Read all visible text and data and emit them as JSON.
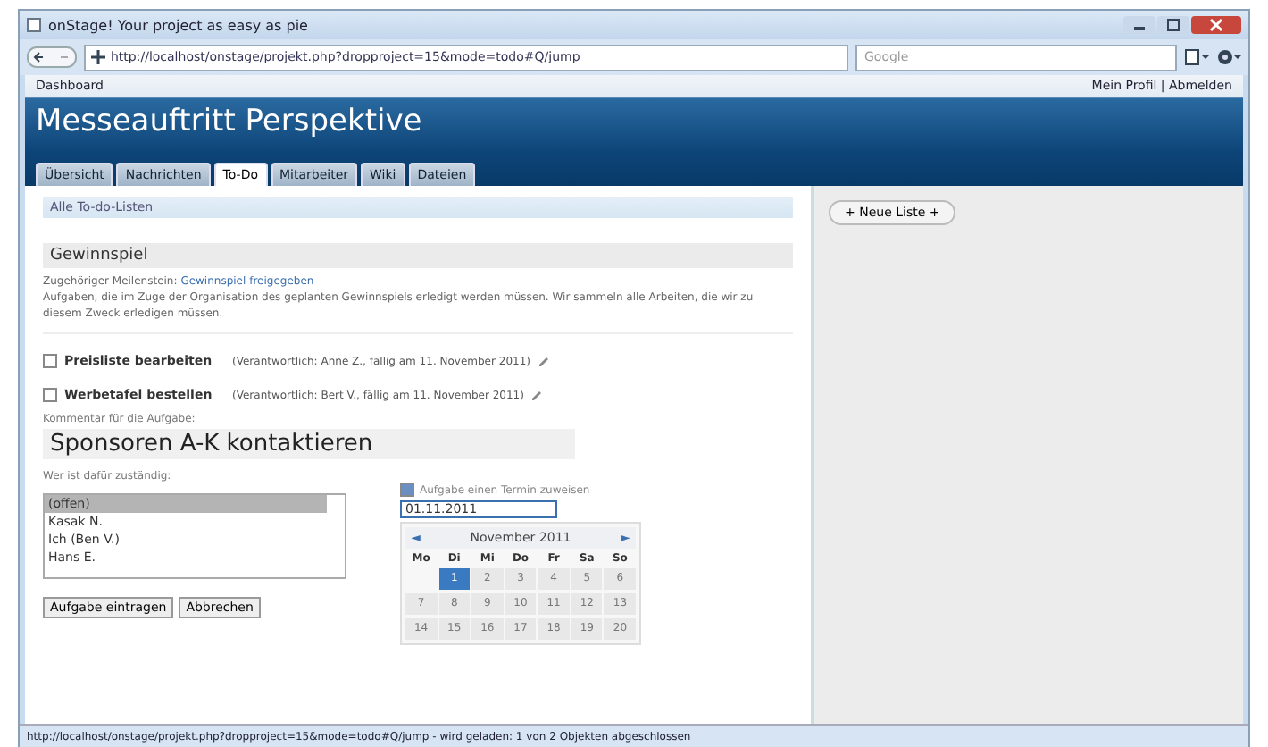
{
  "window": {
    "title": "onStage! Your project as easy as pie"
  },
  "browser": {
    "url": "http://localhost/onstage/projekt.php?dropproject=15&mode=todo#Q/jump",
    "search_placeholder": "Google"
  },
  "header": {
    "breadcrumb": "Dashboard",
    "user_links": "Mein Profil | Abmelden",
    "title": "Messeauftritt Perspektive"
  },
  "tabs": [
    {
      "label": "Übersicht",
      "selected": false
    },
    {
      "label": "Nachrichten",
      "selected": false
    },
    {
      "label": "To-Do",
      "selected": true
    },
    {
      "label": "Mitarbeiter",
      "selected": false
    },
    {
      "label": "Wiki",
      "selected": false
    },
    {
      "label": "Dateien",
      "selected": false
    }
  ],
  "all_lists_link": "Alle To-do-Listen",
  "list": {
    "title": "Gewinnspiel",
    "milestone_label": "Zugehöriger Meilenstein:",
    "milestone_link": "Gewinnspiel freigegeben",
    "description": "Aufgaben, die im Zuge der Organisation des geplanten Gewinnspiels erledigt werden müssen. Wir sammeln alle Arbeiten, die wir zu diesem Zweck erledigen müssen.",
    "tasks": [
      {
        "name": "Preisliste bearbeiten",
        "meta": "(Verantwortlich: Anne Z., fällig am 11. November 2011)",
        "checked": false
      },
      {
        "name": "Werbetafel bestellen",
        "meta": "(Verantwortlich: Bert V., fällig am 11. November 2011)",
        "checked": false
      }
    ]
  },
  "form": {
    "comment_label": "Kommentar für die Aufgabe:",
    "comment_value": "Sponsoren A-K kontaktieren",
    "assignee_label": "Wer ist dafür zuständig:",
    "assignees": [
      {
        "label": "(offen)",
        "selected": true
      },
      {
        "label": "Kasak N.",
        "selected": false
      },
      {
        "label": "Ich (Ben V.)",
        "selected": false
      },
      {
        "label": "Hans E.",
        "selected": false
      }
    ],
    "due_label": "Aufgabe einen Termin zuweisen",
    "due_checked": true,
    "due_value": "01.11.2011",
    "buttons": [
      "Aufgabe eintragen",
      "Abbrechen"
    ]
  },
  "calendar": {
    "prev": "◄",
    "month": "November 2011",
    "next": "►",
    "weekdays": [
      "Mo",
      "Di",
      "Mi",
      "Do",
      "Fr",
      "Sa",
      "So"
    ],
    "weeks": [
      [
        {
          "kind": "blank"
        },
        {
          "d": "1",
          "selected": true
        },
        {
          "d": "2",
          "selected": false
        },
        {
          "d": "3",
          "selected": false
        },
        {
          "d": "4",
          "selected": false
        },
        {
          "d": "5",
          "selected": false
        },
        {
          "d": "6",
          "selected": false
        }
      ],
      [
        {
          "d": "7",
          "selected": false
        },
        {
          "d": "8",
          "selected": false
        },
        {
          "d": "9",
          "selected": false
        },
        {
          "d": "10",
          "selected": false
        },
        {
          "d": "11",
          "selected": false
        },
        {
          "d": "12",
          "selected": false
        },
        {
          "d": "13",
          "selected": false
        }
      ],
      [
        {
          "d": "14",
          "selected": false
        },
        {
          "d": "15",
          "selected": false
        },
        {
          "d": "16",
          "selected": false
        },
        {
          "d": "17",
          "selected": false
        },
        {
          "d": "18",
          "selected": false
        },
        {
          "d": "19",
          "selected": false
        },
        {
          "d": "20",
          "selected": false
        }
      ]
    ]
  },
  "sidebar": {
    "new_list_button": "+ Neue Liste +"
  },
  "status_bar": "http://localhost/onstage/projekt.php?dropproject=15&mode=todo#Q/jump - wird geladen: 1 von 2 Objekten abgeschlossen"
}
